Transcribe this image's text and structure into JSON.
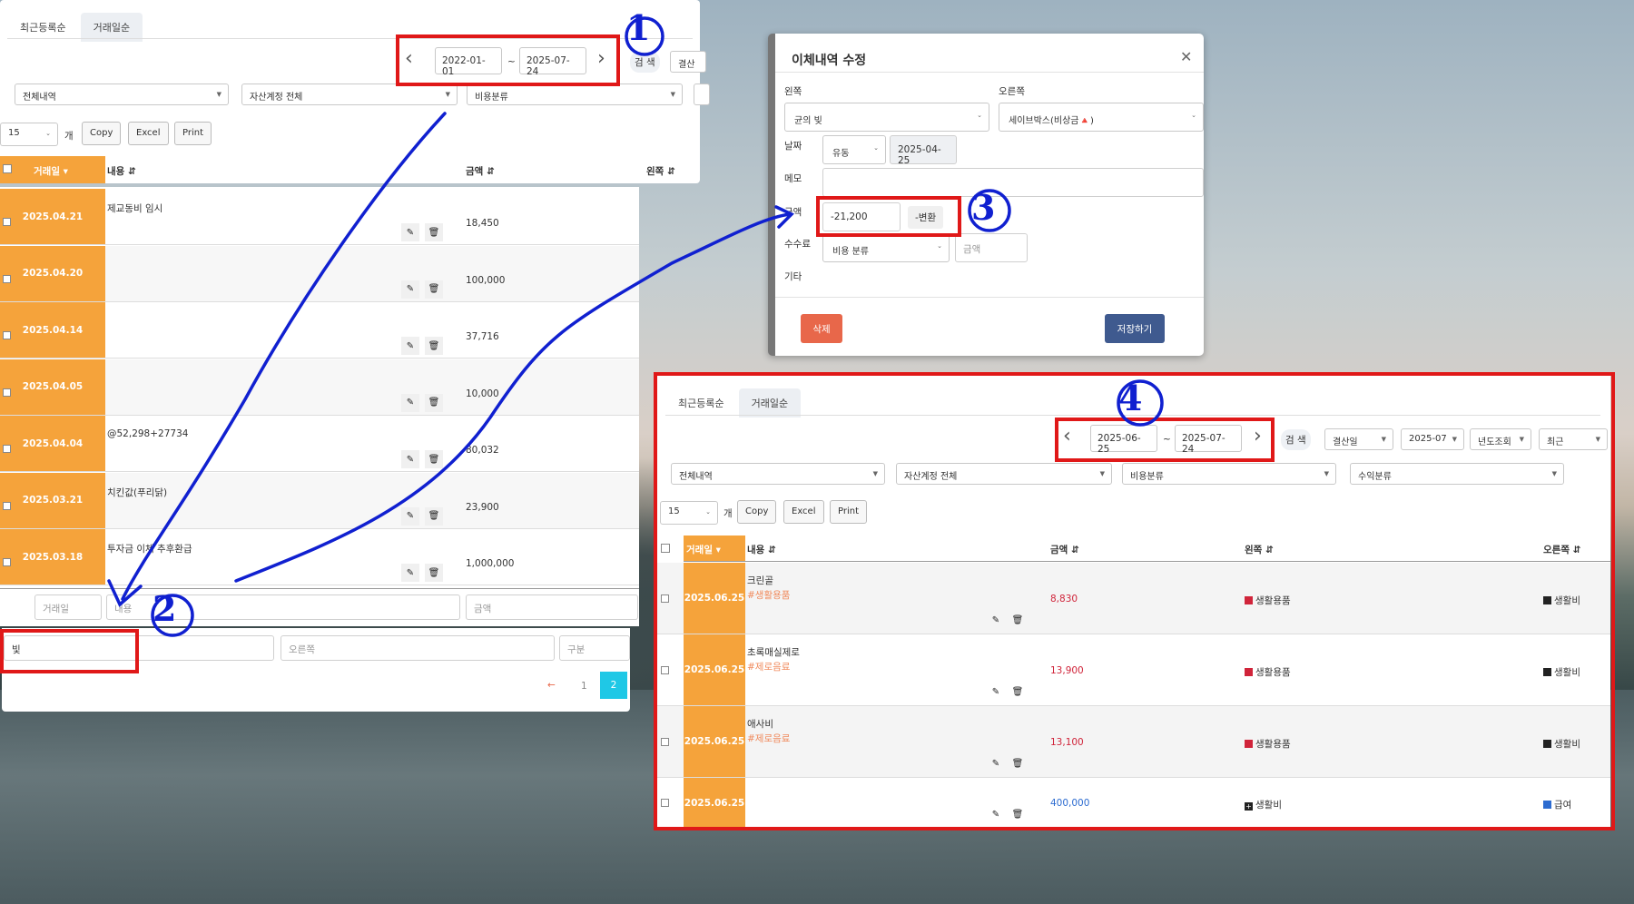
{
  "panel1": {
    "tabs": [
      "최근등록순",
      "거래일순"
    ],
    "date_from": "2022-01-01",
    "date_to": "2025-07-24",
    "tilde": "~",
    "search_label": "검 색",
    "settle_label": "결산일",
    "filters": [
      "전체내역",
      "자산계정 전체",
      "비용분류"
    ],
    "page_size": "15",
    "page_size_unit": "개",
    "buttons": [
      "Copy",
      "Excel",
      "Print"
    ],
    "headers": {
      "date": "거래일",
      "content": "내용",
      "amount": "금액",
      "left": "왼쪽"
    },
    "rows": [
      {
        "date": "2025.04.21",
        "content": "제교동비 임시",
        "amount": "18,450"
      },
      {
        "date": "2025.04.20",
        "content": "",
        "amount": "100,000"
      },
      {
        "date": "2025.04.14",
        "content": "",
        "amount": "37,716"
      },
      {
        "date": "2025.04.05",
        "content": "",
        "amount": "10,000"
      },
      {
        "date": "2025.04.04",
        "content": "@52,298+27734",
        "amount": "80,032"
      },
      {
        "date": "2025.03.21",
        "content": "치킨값(푸리닭)",
        "amount": "23,900"
      },
      {
        "date": "2025.03.18",
        "content": "투자금 이체 추후환급",
        "amount": "1,000,000"
      }
    ],
    "footer_placeholders": {
      "date": "거래일",
      "content": "내용",
      "amount": "금액",
      "left_value": "빛",
      "right": "오른쪽",
      "category": "구분"
    },
    "pagination": {
      "prev": "←",
      "pages": [
        "1",
        "2"
      ],
      "active": "2"
    }
  },
  "modal": {
    "title": "이체내역 수정",
    "close": "✕",
    "left_label": "왼쪽",
    "right_label": "오른쪽",
    "left_value": "균의 빚",
    "right_value": "세이브박스(비상금🔺)",
    "date_label": "날짜",
    "date_type": "유동",
    "date_value": "2025-04-25",
    "memo_label": "메모",
    "amount_label": "금액",
    "amount_value": "-21,200",
    "convert_label": "-변환",
    "fee_label": "수수료",
    "fee_category": "비용 분류",
    "fee_amount_placeholder": "금액",
    "etc_label": "기타",
    "delete_label": "삭제",
    "save_label": "저장하기"
  },
  "panel2": {
    "tabs": [
      "최근등록순",
      "거래일순"
    ],
    "date_from": "2025-06-25",
    "date_to": "2025-07-24",
    "tilde": "~",
    "search_label": "검 색",
    "dropdowns": [
      "결산일",
      "2025-07",
      "년도조회",
      "최근"
    ],
    "filters": [
      "전체내역",
      "자산계정 전체",
      "비용분류",
      "수익분류"
    ],
    "page_size": "15",
    "page_size_unit": "개",
    "buttons": [
      "Copy",
      "Excel",
      "Print"
    ],
    "headers": {
      "date": "거래일",
      "content": "내용",
      "amount": "금액",
      "left": "왼쪽",
      "right": "오른쪽"
    },
    "rows": [
      {
        "date": "2025.06.25",
        "content": "크린골",
        "tag": "#생활용품",
        "amount": "8,830",
        "left": "생활용품",
        "right": "생활비"
      },
      {
        "date": "2025.06.25",
        "content": "초록매실제로",
        "tag": "#제로음료",
        "amount": "13,900",
        "left": "생활용품",
        "right": "생활비"
      },
      {
        "date": "2025.06.25",
        "content": "애사비",
        "tag": "#제로음료",
        "amount": "13,100",
        "left": "생활용품",
        "right": "생활비"
      },
      {
        "date": "2025.06.25",
        "content": "",
        "tag": "",
        "amount": "400,000",
        "left": "생활비",
        "right": "급여"
      }
    ]
  },
  "annotations": [
    "1",
    "2",
    "3",
    "4"
  ],
  "colors": {
    "date_cell": "#f5a33b",
    "annotation_red": "#e01818",
    "annotation_blue": "#1020d0",
    "delete_btn": "#e8674a",
    "save_btn": "#3f5a8f",
    "expense_amount": "#d0243a",
    "income_amount": "#2c6bd0"
  }
}
